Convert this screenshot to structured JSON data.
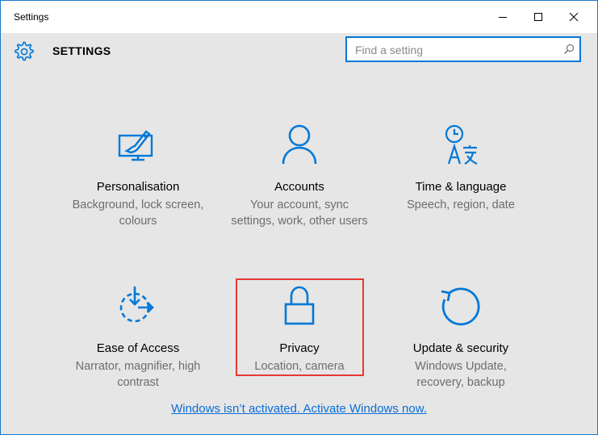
{
  "window": {
    "title": "Settings"
  },
  "header": {
    "title": "SETTINGS",
    "search_placeholder": "Find a setting"
  },
  "tiles": [
    {
      "title": "Personalisation",
      "subtitle": "Background, lock screen, colours",
      "icon": "personalisation-icon"
    },
    {
      "title": "Accounts",
      "subtitle": "Your account, sync settings, work, other users",
      "icon": "accounts-icon"
    },
    {
      "title": "Time & language",
      "subtitle": "Speech, region, date",
      "icon": "time-language-icon"
    },
    {
      "title": "Ease of Access",
      "subtitle": "Narrator, magnifier, high contrast",
      "icon": "ease-of-access-icon"
    },
    {
      "title": "Privacy",
      "subtitle": "Location, camera",
      "icon": "privacy-icon"
    },
    {
      "title": "Update & security",
      "subtitle": "Windows Update, recovery, backup",
      "icon": "update-security-icon"
    }
  ],
  "activation": {
    "link_text": "Windows isn’t activated. Activate Windows now."
  },
  "colors": {
    "accent": "#0078d7",
    "highlight": "#e53935",
    "link": "#0a6dd6"
  }
}
